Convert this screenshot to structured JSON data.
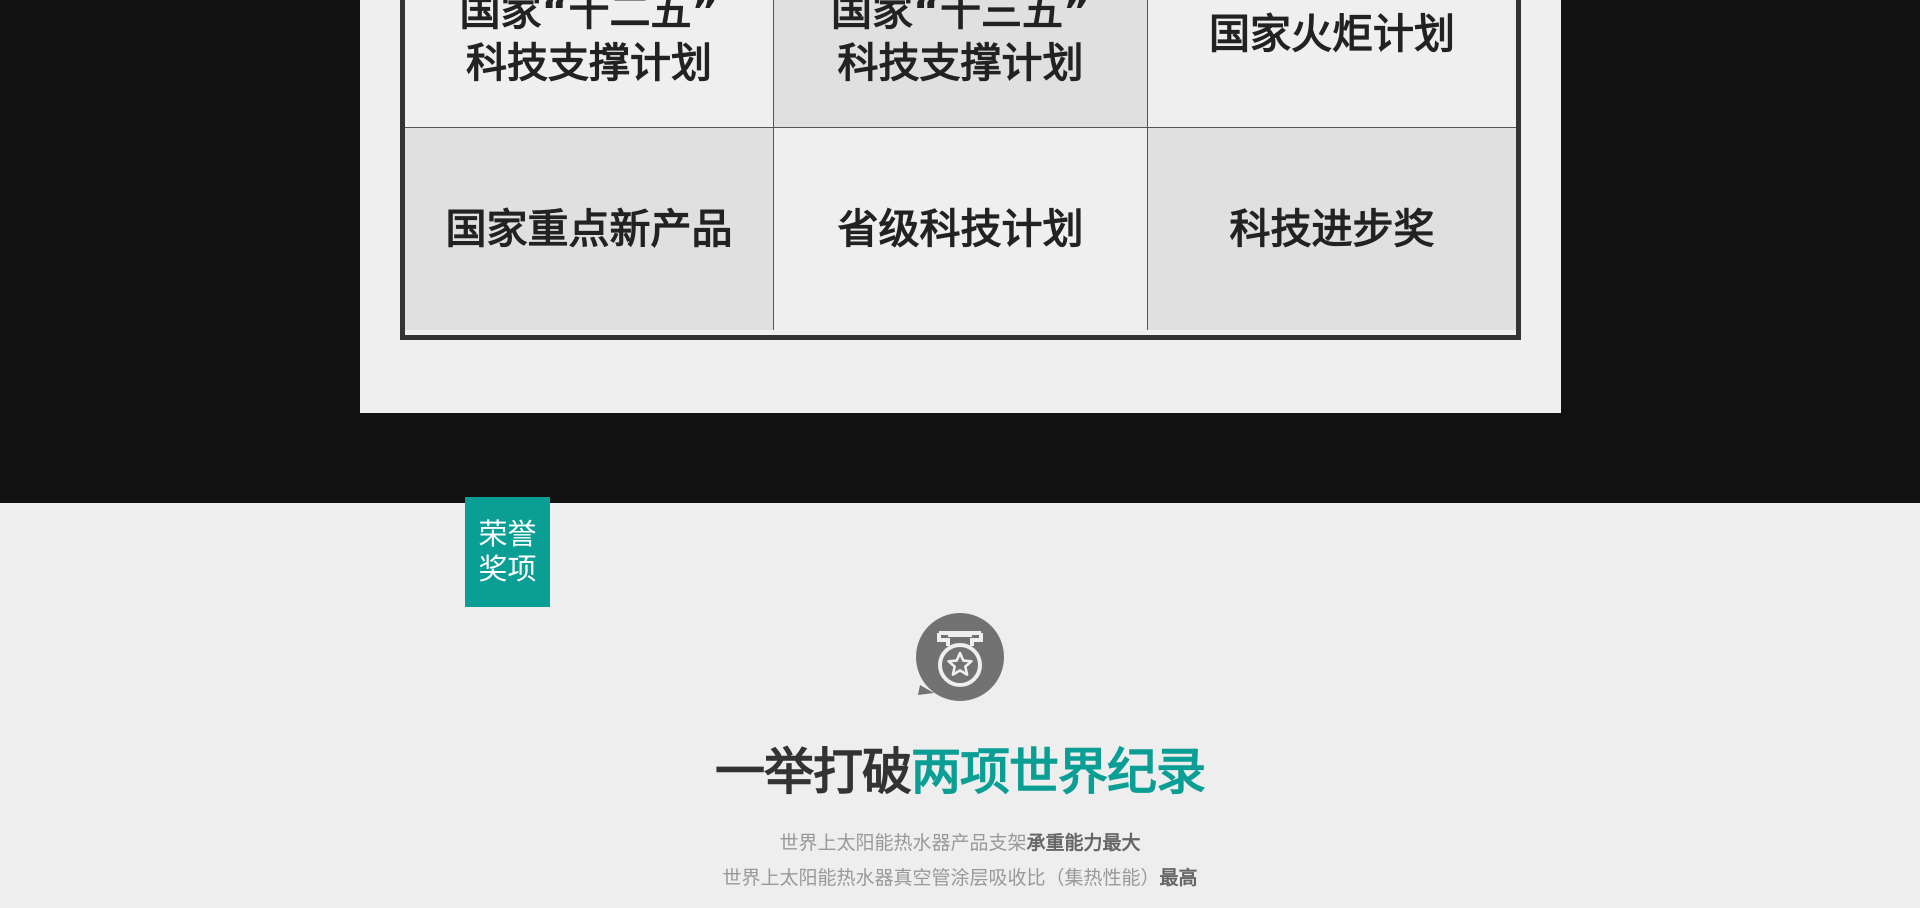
{
  "awards": {
    "rows": [
      [
        {
          "lines": [
            "国家“十二五”",
            "科技支撑计划"
          ]
        },
        {
          "lines": [
            "国家“十三五”",
            "科技支撑计划"
          ]
        },
        {
          "lines": [
            "国家火炬计划"
          ]
        }
      ],
      [
        {
          "lines": [
            "国家重点新产品"
          ]
        },
        {
          "lines": [
            "省级科技计划"
          ]
        },
        {
          "lines": [
            "科技进步奖"
          ]
        }
      ]
    ]
  },
  "tag": {
    "line1": "荣誉",
    "line2": "奖项"
  },
  "medal_icon": "medal-badge-icon",
  "headline": {
    "plain": "一举打破",
    "accent": "两项世界纪录"
  },
  "description": {
    "line1_plain": "世界上太阳能热水器产品支架",
    "line1_strong": "承重能力最大",
    "line2_plain": "世界上太阳能热水器真空管涂层吸收比（集热性能）",
    "line2_strong": "最高"
  },
  "colors": {
    "accent": "#0b9e94",
    "dark_band": "#111111",
    "panel": "#efefef",
    "text": "#333333"
  }
}
